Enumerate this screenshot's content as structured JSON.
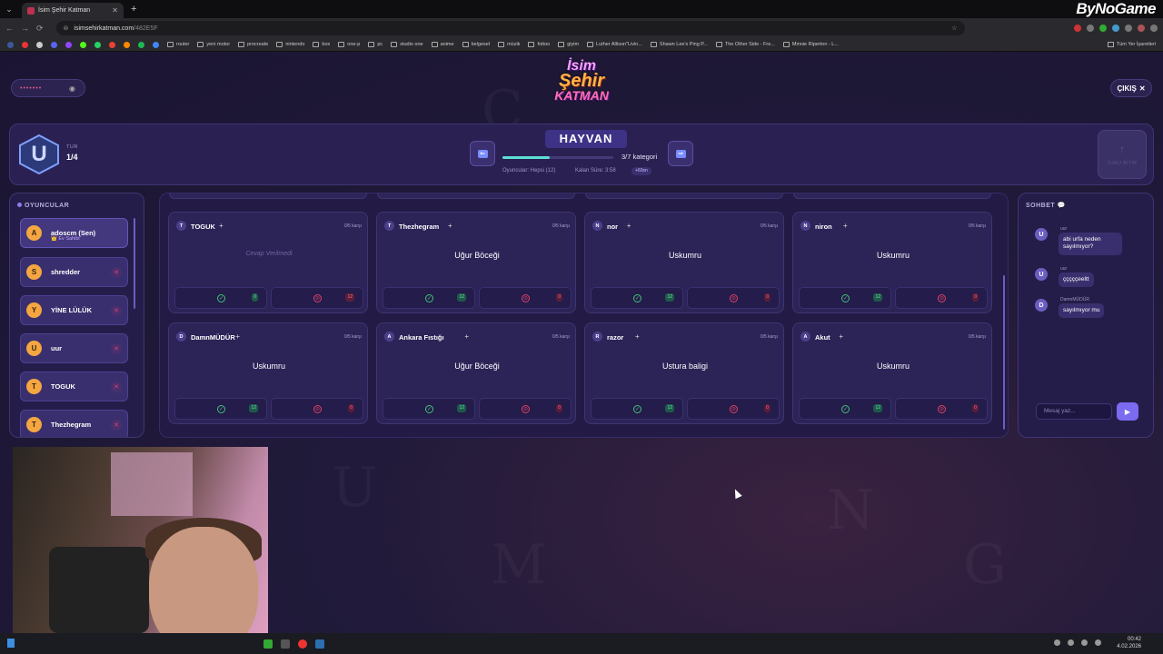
{
  "browser": {
    "tab_title": "İsim Şehir Katman",
    "url_host": "isimsehirkatman.com",
    "url_path": "/482E5F",
    "watermark": "ByNoGame",
    "bookmarks": [
      "router",
      "yeni motor",
      "procreate",
      "nintendo",
      "box",
      "one-p",
      "pc",
      "studio one",
      "anime",
      "belgesel",
      "müzik",
      "fottoo",
      "giyim",
      "Luther Allison\"Livin...",
      "Shawn Lee's Ping P...",
      "The Other Side - Fre...",
      "Minnie Riperton - L..."
    ],
    "bookmarks_right": "Tüm Yer İşaretleri"
  },
  "logo": {
    "line1": "İsim",
    "line2": "Şehir",
    "line3": "KATMAN"
  },
  "room_code": "•••••••",
  "exit_label": "ÇIKIŞ",
  "round": {
    "badge_letter": "U",
    "label": "TUR",
    "value": "1/4"
  },
  "category": {
    "title": "HAYVAN",
    "progress_text": "3/7 kategori",
    "progress_fraction": 0.43,
    "players_info": "Oyuncular: Hepsi (12)",
    "time_info": "Kalan Süre: 3:58",
    "bonus": "+60sn"
  },
  "finish_label": "TURU BİTİR",
  "players": {
    "title": "OYUNCULAR",
    "list": [
      {
        "initial": "A",
        "name": "adoscm (Sen)",
        "sub": "👑 Ev Sahibi",
        "me": true
      },
      {
        "initial": "S",
        "name": "shredder"
      },
      {
        "initial": "Y",
        "name": "YİNE LÜLÜK"
      },
      {
        "initial": "U",
        "name": "uur"
      },
      {
        "initial": "T",
        "name": "TOGUK"
      },
      {
        "initial": "T",
        "name": "Thezhegram"
      }
    ]
  },
  "answers": [
    {
      "initial": "T",
      "name": "TOGUK",
      "votes": "0/5 karşı",
      "answer": "Cevap Verilmedi",
      "empty": true,
      "ok": "0",
      "no": "12"
    },
    {
      "initial": "T",
      "name": "Thezhegram",
      "votes": "0/5 karşı",
      "answer": "Uğur Böceği",
      "ok": "12",
      "no": "0"
    },
    {
      "initial": "N",
      "name": "nor",
      "votes": "0/5 karşı",
      "answer": "Uskumru",
      "ok": "12",
      "no": "0"
    },
    {
      "initial": "N",
      "name": "niron",
      "votes": "0/5 karşı",
      "answer": "Uskumru",
      "ok": "12",
      "no": "0"
    },
    {
      "initial": "D",
      "name": "DamnMÜDÜR",
      "votes": "0/5 karşı",
      "answer": "Uskumru",
      "ok": "12",
      "no": "0"
    },
    {
      "initial": "A",
      "name": "Ankara Fıstığı",
      "votes": "0/5 karşı",
      "answer": "Uğur Böceği",
      "ok": "12",
      "no": "0"
    },
    {
      "initial": "R",
      "name": "razor",
      "votes": "0/5 karşı",
      "answer": "Ustura baligi",
      "ok": "12",
      "no": "0"
    },
    {
      "initial": "A",
      "name": "Akut",
      "votes": "0/5 karşı",
      "answer": "Uskumru",
      "ok": "12",
      "no": "0"
    }
  ],
  "chat": {
    "title": "SOHBET",
    "messages": [
      {
        "initial": "U",
        "author": "uur",
        "text": "abi urfa neden sayılmıyor?"
      },
      {
        "initial": "U",
        "author": "uur",
        "text": "çççççeeltt"
      },
      {
        "initial": "D",
        "author": "DamnMÜDÜR",
        "text": "sayılmıyor mu"
      }
    ],
    "input_placeholder": "Mesaj yaz..."
  },
  "taskbar": {
    "time": "00:42",
    "date": "4.02.2026"
  },
  "colors": {
    "accent": "#7b6bf0",
    "bg": "#1b1533",
    "ok": "#43c07a",
    "no": "#e0406a"
  }
}
